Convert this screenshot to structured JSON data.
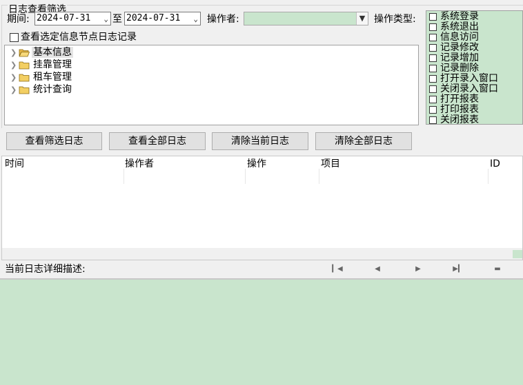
{
  "filter": {
    "title": "日志查看筛选",
    "period_label": "期间:",
    "date_from": "2024-07-31",
    "to_label": "至",
    "date_to": "2024-07-31",
    "operator_label": "操作者:",
    "operator_value": "",
    "optype_label": "操作类型:",
    "selected_node_only_label": "查看选定信息节点日志记录",
    "colors": {
      "accent_green": "#c9e5cd"
    }
  },
  "tree": {
    "items": [
      {
        "label": "基本信息",
        "selected": true,
        "icon": "open-folder-icon"
      },
      {
        "label": "挂靠管理",
        "selected": false,
        "icon": "folder-icon"
      },
      {
        "label": "租车管理",
        "selected": false,
        "icon": "folder-icon"
      },
      {
        "label": "统计查询",
        "selected": false,
        "icon": "folder-icon"
      }
    ]
  },
  "op_types": [
    "系统登录",
    "系统退出",
    "信息访问",
    "记录修改",
    "记录增加",
    "记录删除",
    "打开录入窗口",
    "关闭录入窗口",
    "打开报表",
    "打印报表",
    "关闭报表"
  ],
  "buttons": {
    "view_filtered": "查看筛选日志",
    "view_all": "查看全部日志",
    "clear_current": "清除当前日志",
    "clear_all": "清除全部日志"
  },
  "grid": {
    "columns": [
      "时间",
      "操作者",
      "操作",
      "项目",
      "ID"
    ],
    "rows": []
  },
  "detail": {
    "label": "当前日志详细描述:",
    "nav_icons": [
      "first-record-icon",
      "prev-record-icon",
      "next-record-icon",
      "last-record-icon",
      "minimize-icon"
    ]
  }
}
